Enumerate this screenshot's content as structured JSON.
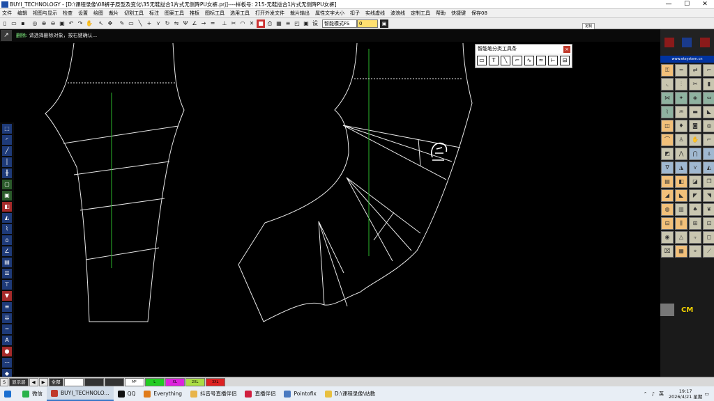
{
  "window": {
    "title": "BUYI_TECHNOLOGY - [D:\\课程录像\\08裤子原型及变化\\35无鞋挞合1片式无侧降PU女裤.prj]----样板号: 215-无鞋挞合1片式无侧降PU女裤]",
    "minimize": "—",
    "maximize": "☐",
    "close": "✕"
  },
  "menu": [
    "文件",
    "编辑",
    "视图与显示",
    "检查",
    "设置",
    "绘图",
    "裁片",
    "切割工具",
    "标注",
    "图案工具",
    "推板",
    "图标工具",
    "选用工具",
    "打开外发文件",
    "裁片输出",
    "属性文字大小",
    "扣子",
    "实线虚线",
    "波浪线",
    "定制工具",
    "帮助",
    "快捷键",
    "保存08"
  ],
  "toolbar": {
    "mode_select": "智能模式FS",
    "value_input": "0",
    "go_icon": "▣",
    "mini_tag": "定制"
  },
  "status": {
    "hint_label": "删除:",
    "hint_text": "请选择删除对象，按右键确认..."
  },
  "smart_toolbar": {
    "title": "智能笔分类工具条",
    "close": "×",
    "tools": [
      "▭",
      "T",
      "╲",
      "⌐",
      "∿",
      "≈",
      "⊢",
      "⊟",
      "⊣"
    ]
  },
  "right_panel": {
    "url": "www.etsystem.cn",
    "cm": "CM"
  },
  "bottom": {
    "layer_label": "显示层",
    "all_label": "全部",
    "nav_left": "◀",
    "nav_right": "▶",
    "swatches": [
      {
        "label": "",
        "color": "#ffffff"
      },
      {
        "label": "",
        "color": "#333333"
      },
      {
        "label": "",
        "color": "#333333"
      },
      {
        "label": "M*",
        "color": "#ffffff"
      },
      {
        "label": "L",
        "color": "#22cc22"
      },
      {
        "label": "XL",
        "color": "#dd22dd"
      },
      {
        "label": "2XL",
        "color": "#aadd44"
      },
      {
        "label": "3XL",
        "color": "#dd2222"
      }
    ]
  },
  "taskbar": {
    "items": [
      {
        "label": "微信",
        "color": "#2ab24a"
      },
      {
        "label": "BUYI_TECHNOLO...",
        "color": "#c0392b"
      },
      {
        "label": "QQ",
        "color": "#111111"
      },
      {
        "label": "Everything",
        "color": "#e07b1a"
      },
      {
        "label": "抖音号直播伴侣",
        "color": "#e8b44a"
      },
      {
        "label": "直播伴侣",
        "color": "#d02040"
      },
      {
        "label": "Pointofix",
        "color": "#4a7ac0"
      },
      {
        "label": "D:\\课程录像\\站教",
        "color": "#e8c040"
      }
    ],
    "ime": "英",
    "time": "19:17",
    "date": "2026/4/21 星期"
  }
}
